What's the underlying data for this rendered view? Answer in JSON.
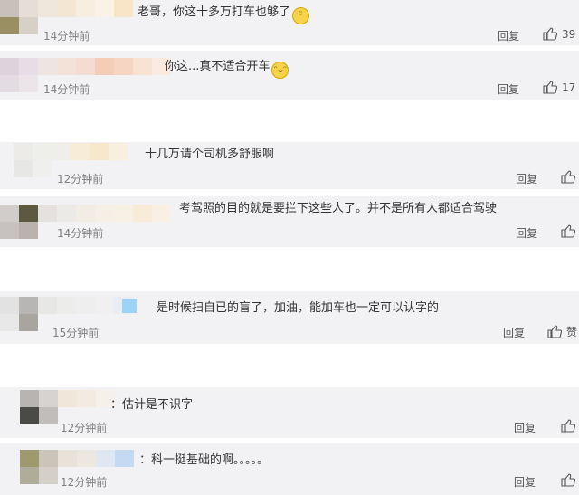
{
  "comments": [
    {
      "text": "老哥，你这十多万打车也够了",
      "emoji": "smirk-emoji",
      "time": "14分钟前",
      "reply": "回复",
      "likes": "39"
    },
    {
      "text": "你这...真不适合开车",
      "emoji": "laugh-cry-emoji",
      "time": "14分钟前",
      "reply": "回复",
      "likes": "17"
    },
    {
      "text": "十几万请个司机多舒服啊",
      "time": "12分钟前",
      "reply": "回复",
      "likes": ""
    },
    {
      "text": "考驾照的目的就是要拦下这些人了。并不是所有人都适合驾驶",
      "time": "14分钟前",
      "reply": "回复",
      "likes": ""
    },
    {
      "text": "是时候扫自已的盲了，加油，能加车也一定可以认字的",
      "time": "15分钟前",
      "reply": "回复",
      "likes": "赞"
    },
    {
      "text": "：估计是不识字",
      "time": "12分钟前",
      "reply": "回复",
      "likes": ""
    },
    {
      "text": "：科一挺基础的啊。。。。。",
      "time": "12分钟前",
      "reply": "回复",
      "likes": ""
    }
  ],
  "colors": {
    "band": "#f2f2f5",
    "time": "#808080",
    "text": "#333333"
  }
}
